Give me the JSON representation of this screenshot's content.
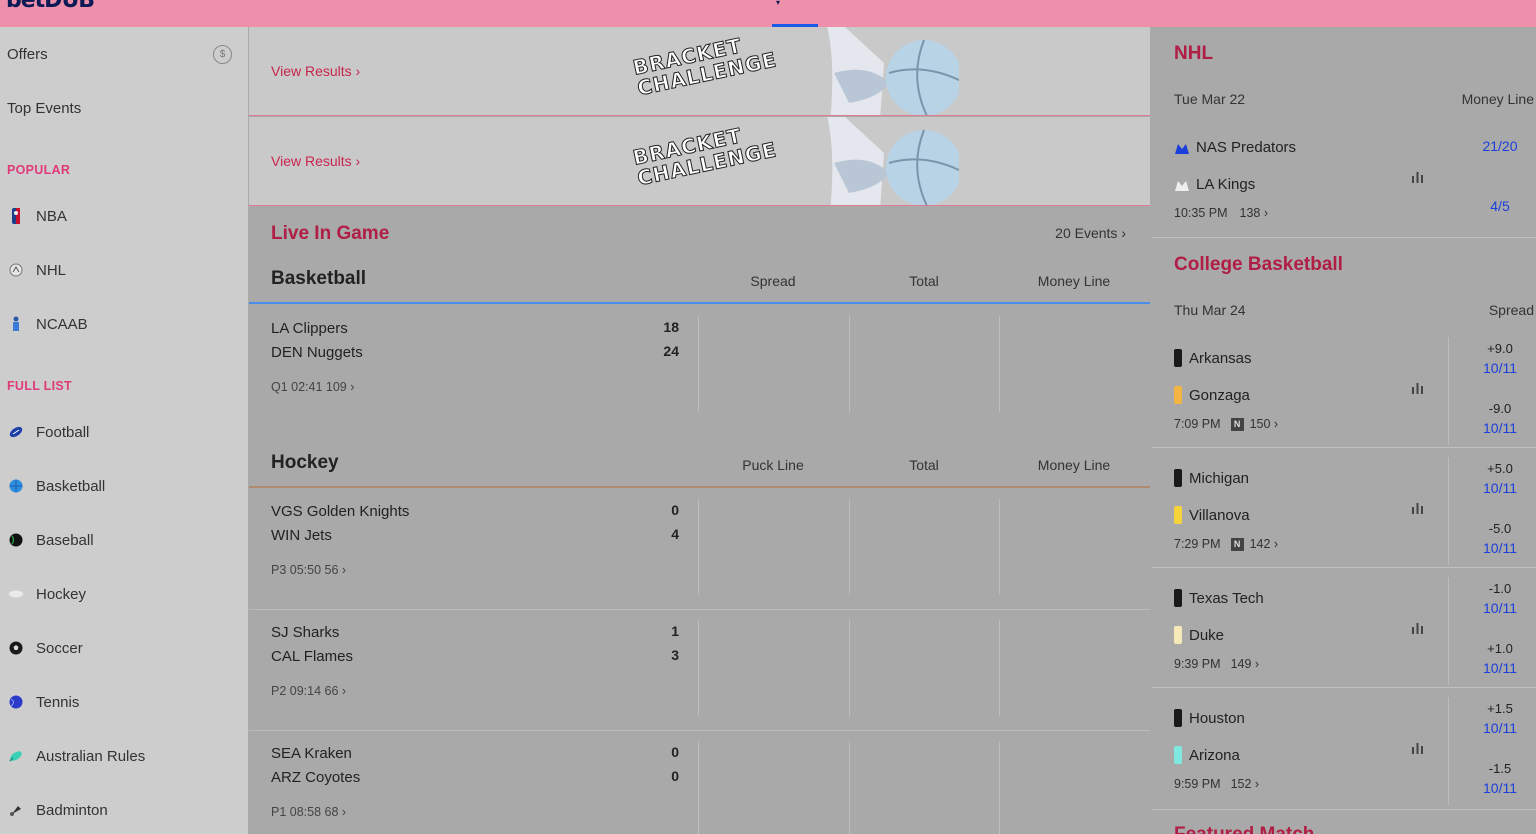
{
  "header": {
    "logo": "betDUB",
    "caret": "▾"
  },
  "sidebar": {
    "top_items": [
      {
        "label": "Offers",
        "badge": "$"
      },
      {
        "label": "Top Events"
      }
    ],
    "popular_heading": "POPULAR",
    "popular": [
      {
        "label": "NBA",
        "icon": "nba-logo-icon"
      },
      {
        "label": "NHL",
        "icon": "nhl-logo-icon"
      },
      {
        "label": "NCAAB",
        "icon": "ncaab-logo-icon"
      }
    ],
    "full_list_heading": "FULL LIST",
    "full_list": [
      {
        "label": "Football",
        "icon": "football-icon"
      },
      {
        "label": "Basketball",
        "icon": "basketball-icon"
      },
      {
        "label": "Baseball",
        "icon": "baseball-icon"
      },
      {
        "label": "Hockey",
        "icon": "hockey-icon"
      },
      {
        "label": "Soccer",
        "icon": "soccer-icon"
      },
      {
        "label": "Tennis",
        "icon": "tennis-icon"
      },
      {
        "label": "Australian Rules",
        "icon": "australian-rules-icon"
      },
      {
        "label": "Badminton",
        "icon": "badminton-icon"
      }
    ]
  },
  "banners": [
    {
      "link": "View Results ›",
      "art_text": "BRACKET\nCHALLENGE"
    },
    {
      "link": "View Results ›",
      "art_text": "BRACKET\nCHALLENGE"
    }
  ],
  "live": {
    "title": "Live In Game",
    "events_link": "20 Events ›",
    "basketball": {
      "name": "Basketball",
      "cols": [
        "Spread",
        "Total",
        "Money Line"
      ],
      "games": [
        {
          "team1": "LA Clippers",
          "team2": "DEN Nuggets",
          "score1": "18",
          "score2": "24",
          "meta": "Q1 02:41    109 ›"
        }
      ]
    },
    "hockey": {
      "name": "Hockey",
      "cols": [
        "Puck Line",
        "Total",
        "Money Line"
      ],
      "games": [
        {
          "team1": "VGS Golden Knights",
          "team2": "WIN Jets",
          "score1": "0",
          "score2": "4",
          "meta": "P3 05:50    56 ›"
        },
        {
          "team1": "SJ Sharks",
          "team2": "CAL Flames",
          "score1": "1",
          "score2": "3",
          "meta": "P2 09:14    66 ›"
        },
        {
          "team1": "SEA Kraken",
          "team2": "ARZ Coyotes",
          "score1": "0",
          "score2": "0",
          "meta": "P1 08:58    68 ›"
        }
      ]
    }
  },
  "right": {
    "nhl": {
      "title": "NHL",
      "date": "Tue Mar 22",
      "col": "Money Line",
      "team1": "NAS Predators",
      "team2": "LA Kings",
      "time": "10:35 PM",
      "count": "138 ›",
      "odd1": "21/20",
      "odd2": "4/5",
      "colors": {
        "team1": "#1a3fdd",
        "team2": "#eeeeee"
      }
    },
    "cbb": {
      "title": "College Basketball",
      "date": "Thu Mar 24",
      "col": "Spread",
      "neutral": "N",
      "games": [
        {
          "team1": "Arkansas",
          "team2": "Gonzaga",
          "time": "7:09 PM",
          "neutral": true,
          "count": "150 ›",
          "line1": "+9.0",
          "odd1": "10/11",
          "line2": "-9.0",
          "odd2": "10/11",
          "c1": "#1a1a1a",
          "c2": "#f2b544"
        },
        {
          "team1": "Michigan",
          "team2": "Villanova",
          "time": "7:29 PM",
          "neutral": true,
          "count": "142 ›",
          "line1": "+5.0",
          "odd1": "10/11",
          "line2": "-5.0",
          "odd2": "10/11",
          "c1": "#1a1a1a",
          "c2": "#f6d33a"
        },
        {
          "team1": "Texas Tech",
          "team2": "Duke",
          "time": "9:39 PM",
          "neutral": false,
          "count": "149 ›",
          "line1": "-1.0",
          "odd1": "10/11",
          "line2": "+1.0",
          "odd2": "10/11",
          "c1": "#1a1a1a",
          "c2": "#f5e9b8"
        },
        {
          "team1": "Houston",
          "team2": "Arizona",
          "time": "9:59 PM",
          "neutral": false,
          "count": "152 ›",
          "line1": "+1.5",
          "odd1": "10/11",
          "line2": "-1.5",
          "odd2": "10/11",
          "c1": "#1a1a1a",
          "c2": "#7fe8e0"
        }
      ]
    },
    "next_title": "Featured Match"
  }
}
